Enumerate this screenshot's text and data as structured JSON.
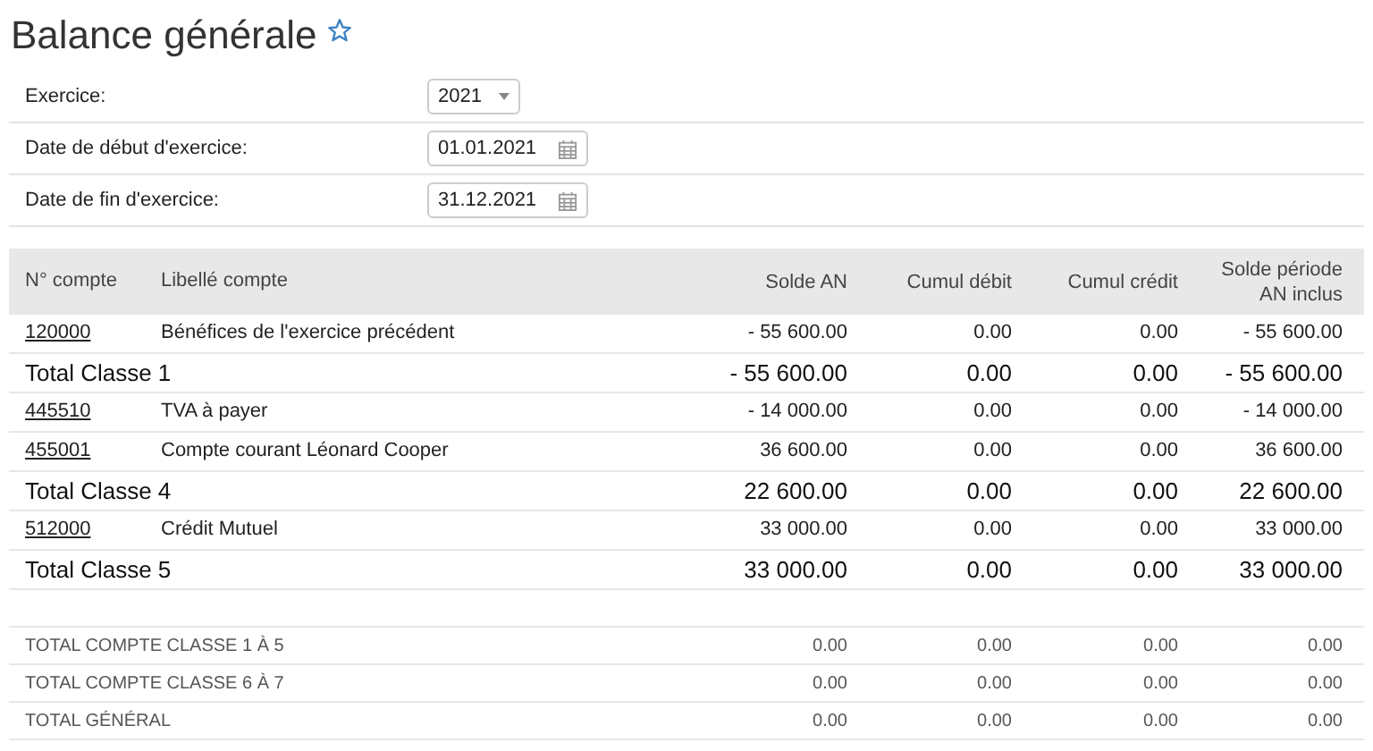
{
  "page": {
    "title": "Balance générale",
    "favorite": false
  },
  "form": [
    {
      "label": "Exercice:",
      "kind": "select",
      "value": "2021"
    },
    {
      "label": "Date de début d'exercice:",
      "kind": "date",
      "value": "01.01.2021"
    },
    {
      "label": "Date de fin d'exercice:",
      "kind": "date",
      "value": "31.12.2021"
    }
  ],
  "table": {
    "columns": [
      "N° compte",
      "Libellé compte",
      "Solde AN",
      "Cumul débit",
      "Cumul crédit",
      "Solde période AN inclus"
    ],
    "rows": [
      {
        "kind": "account",
        "account": "120000",
        "label": "Bénéfices de l'exercice précédent",
        "values": [
          "- 55 600.00",
          "0.00",
          "0.00",
          "- 55 600.00"
        ]
      },
      {
        "kind": "total",
        "label": "Total Classe 1",
        "values": [
          "- 55 600.00",
          "0.00",
          "0.00",
          "- 55 600.00"
        ]
      },
      {
        "kind": "account",
        "account": "445510",
        "label": "TVA à payer",
        "values": [
          "- 14 000.00",
          "0.00",
          "0.00",
          "- 14 000.00"
        ]
      },
      {
        "kind": "account",
        "account": "455001",
        "label": "Compte courant Léonard Cooper",
        "values": [
          "36 600.00",
          "0.00",
          "0.00",
          "36 600.00"
        ]
      },
      {
        "kind": "total",
        "label": "Total Classe 4",
        "values": [
          "22 600.00",
          "0.00",
          "0.00",
          "22 600.00"
        ]
      },
      {
        "kind": "account",
        "account": "512000",
        "label": "Crédit Mutuel",
        "values": [
          "33 000.00",
          "0.00",
          "0.00",
          "33 000.00"
        ]
      },
      {
        "kind": "total",
        "label": "Total Classe 5",
        "values": [
          "33 000.00",
          "0.00",
          "0.00",
          "33 000.00"
        ]
      }
    ],
    "summary_rows": [
      {
        "label": "TOTAL COMPTE CLASSE 1 À 5",
        "values": [
          "0.00",
          "0.00",
          "0.00",
          "0.00"
        ]
      },
      {
        "label": "TOTAL COMPTE CLASSE 6 À 7",
        "values": [
          "0.00",
          "0.00",
          "0.00",
          "0.00"
        ]
      },
      {
        "label": "TOTAL GÉNÉRAL",
        "values": [
          "0.00",
          "0.00",
          "0.00",
          "0.00"
        ]
      }
    ]
  }
}
